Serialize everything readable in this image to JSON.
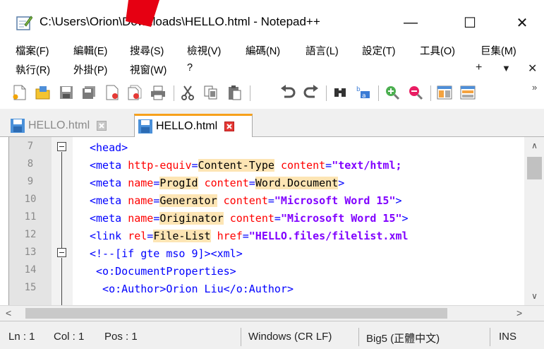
{
  "window": {
    "title": "C:\\Users\\Orion\\Downloads\\HELLO.html - Notepad++",
    "minimize_glyph": "—",
    "maximize_glyph": "☐",
    "close_glyph": "✕"
  },
  "menu": {
    "row1": [
      "檔案(F)",
      "編輯(E)",
      "搜尋(S)",
      "檢視(V)",
      "編碼(N)",
      "語言(L)",
      "設定(T)",
      "工具(O)",
      "巨集(M)"
    ],
    "row2": [
      "執行(R)",
      "外掛(P)",
      "視窗(W)",
      "?"
    ],
    "extra": {
      "add": "+",
      "dropdown": "▼",
      "close": "✕"
    }
  },
  "toolbar": {
    "icons": [
      "new-file-icon",
      "open-file-icon",
      "save-icon",
      "save-all-icon",
      "close-icon",
      "close-all-icon",
      "print-icon",
      "cut-icon",
      "copy-icon",
      "paste-icon",
      "undo-icon",
      "redo-icon",
      "find-icon",
      "replace-icon",
      "zoom-in-icon",
      "zoom-out-icon",
      "sync-vertical-icon",
      "sync-horizontal-icon"
    ],
    "overflow": "»"
  },
  "tabs": [
    {
      "label": "HELLO.html",
      "active": false
    },
    {
      "label": "HELLO.html",
      "active": true
    }
  ],
  "editor": {
    "lines": [
      {
        "num": "7",
        "html": "<span class=\"tag\">&lt;head&gt;</span>"
      },
      {
        "num": "8",
        "html": "<span class=\"tag\">&lt;meta </span><span class=\"attr\">http-equiv</span><span class=\"tag\">=</span><span class=\"hl\">Content-Type</span> <span class=\"attr\">content</span><span class=\"tag\">=</span><span class=\"val\">\"text/html; </span>"
      },
      {
        "num": "9",
        "html": "<span class=\"tag\">&lt;meta </span><span class=\"attr\">name</span><span class=\"tag\">=</span><span class=\"hl\">ProgId</span> <span class=\"attr\">content</span><span class=\"tag\">=</span><span class=\"hl\">Word.Document</span><span class=\"tag\">&gt;</span>"
      },
      {
        "num": "10",
        "html": "<span class=\"tag\">&lt;meta </span><span class=\"attr\">name</span><span class=\"tag\">=</span><span class=\"hl\">Generator</span> <span class=\"attr\">content</span><span class=\"tag\">=</span><span class=\"val\">\"Microsoft Word 15\"</span><span class=\"tag\">&gt;</span>"
      },
      {
        "num": "11",
        "html": "<span class=\"tag\">&lt;meta </span><span class=\"attr\">name</span><span class=\"tag\">=</span><span class=\"hl\">Originator</span> <span class=\"attr\">content</span><span class=\"tag\">=</span><span class=\"val\">\"Microsoft Word 15\"</span><span class=\"tag\">&gt;</span>"
      },
      {
        "num": "12",
        "html": "<span class=\"tag\">&lt;link </span><span class=\"attr\">rel</span><span class=\"tag\">=</span><span class=\"hl\">File-List</span> <span class=\"attr\">href</span><span class=\"tag\">=</span><span class=\"val\">\"HELLO.files/filelist.xml</span>"
      },
      {
        "num": "13",
        "html": "<span class=\"tag\">&lt;!--[if gte mso 9]&gt;&lt;xml&gt;</span>"
      },
      {
        "num": "14",
        "html": "<span class=\"tag\"> &lt;o:DocumentProperties&gt;</span>"
      },
      {
        "num": "15",
        "html": "<span class=\"tag\">  &lt;o:Author&gt;Orion Liu&lt;/o:Author&gt;</span>"
      }
    ]
  },
  "scroll": {
    "up": "∧",
    "down": "∨",
    "left": "<",
    "right": ">"
  },
  "status": {
    "ln": "Ln : 1",
    "col": "Col : 1",
    "pos": "Pos : 1",
    "eol": "Windows (CR LF)",
    "encoding": "Big5 (正體中文)",
    "mode": "INS"
  }
}
